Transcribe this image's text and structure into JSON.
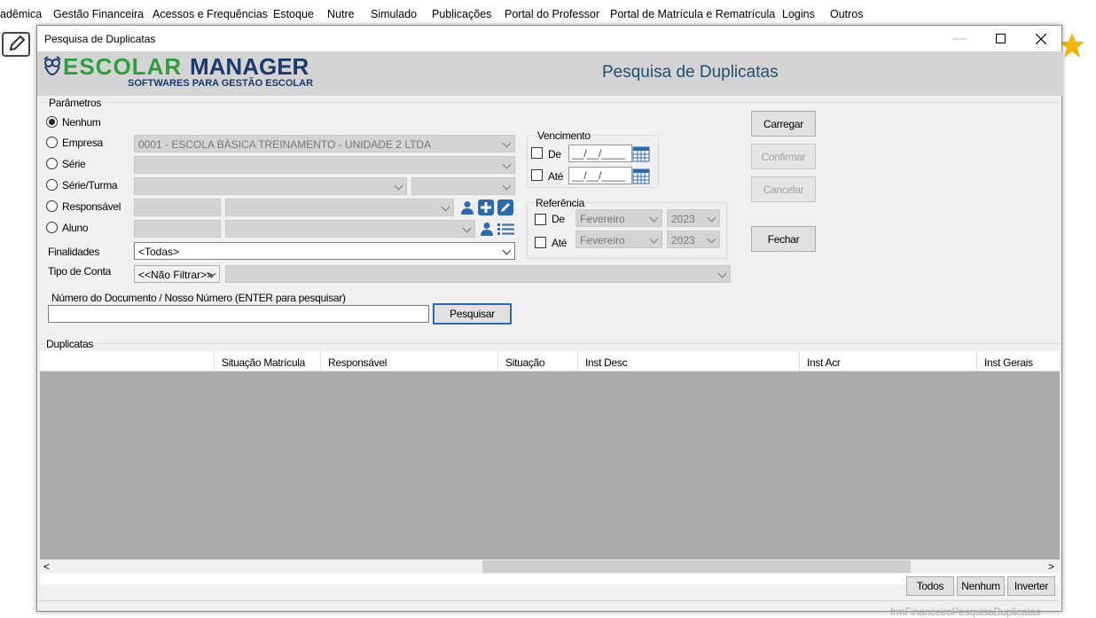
{
  "menubar": [
    "adêmica",
    "Gestão Financeira",
    "Acessos e Frequências",
    "Estoque",
    "Nutre",
    "Simulado",
    "Publicações",
    "Portal do Professor",
    "Portal de Matrícula e Rematrícula",
    "Logins",
    "Outros"
  ],
  "window": {
    "title": "Pesquisa de Duplicatas"
  },
  "banner": {
    "logo_main": "ESCOLAR",
    "logo_manager": "MANAGER",
    "logo_sub": "SOFTWARES PARA GESTÃO ESCOLAR",
    "heading": "Pesquisa de Duplicatas"
  },
  "params": {
    "group_label": "Parâmetros",
    "radios": [
      "Nenhum",
      "Empresa",
      "Série",
      "Série/Turma",
      "Responsável",
      "Aluno"
    ],
    "selected": "Nenhum",
    "empresa_value": "0001 - ESCOLA BÁSICA TREINAMENTO - UNIDADE 2 LTDA",
    "finalidades_label": "Finalidades",
    "finalidades_value": "<Todas>",
    "tipo_conta_label": "Tipo de Conta",
    "tipo_conta_value": "<<Não Filtrar>>",
    "doc_label": "Número do Documento / Nosso Número (ENTER para pesquisar)",
    "doc_value": "",
    "search_button": "Pesquisar"
  },
  "vencimento": {
    "label": "Vencimento",
    "de": "De",
    "ate": "Até",
    "de_value": "__/__/____",
    "ate_value": "__/__/____"
  },
  "referencia": {
    "label": "Referência",
    "de": "De",
    "ate": "Até",
    "de_month": "Fevereiro",
    "de_year": "2023",
    "ate_month": "Fevereiro",
    "ate_year": "2023"
  },
  "actions": {
    "carregar": "Carregar",
    "confirmar": "Confirmar",
    "cancelar": "Cancelar",
    "fechar": "Fechar"
  },
  "duplicatas": {
    "group_label": "Duplicatas",
    "columns": [
      "Situação Matrícula",
      "Responsável",
      "Situação",
      "Inst Desc",
      "Inst Acr",
      "Inst Gerais"
    ]
  },
  "footer": {
    "todos": "Todos",
    "nenhum": "Nenhum",
    "inverter": "Inverter",
    "form_name": "frmFinanceiroPesquisaDuplicatas"
  },
  "colors": {
    "accent_blue": "#2a6ab5",
    "logo_green": "#2e9e3e",
    "logo_navy": "#1b3a6b",
    "grid_gray": "#ababab"
  }
}
